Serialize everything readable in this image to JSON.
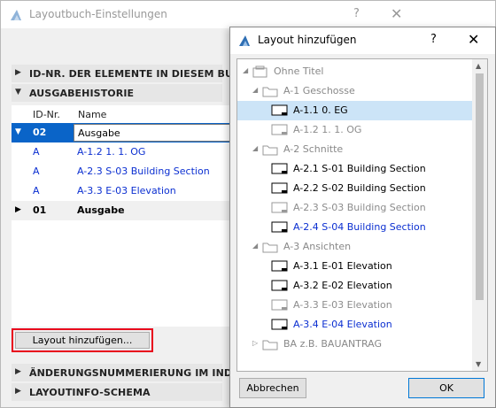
{
  "bg_window": {
    "title": "Layoutbuch-Einstellungen",
    "help": "?",
    "close": "✕",
    "sections": {
      "id_numbers": "ID-NR. DER ELEMENTE IN DIESEM BUCH",
      "history": "AUSGABEHISTORIE",
      "change_numbering": "ÄNDERUNGSNUMMERIERUNG IM INDEX",
      "layoutinfo": "LAYOUTINFO-SCHEMA"
    },
    "history_table": {
      "col_id": "ID-Nr.",
      "col_name": "Name",
      "rows": [
        {
          "id": "02",
          "name": "Ausgabe"
        },
        {
          "id": "A",
          "name": "A-1.2 1. 1. OG"
        },
        {
          "id": "A",
          "name": "A-2.3 S-03 Building Section"
        },
        {
          "id": "A",
          "name": "A-3.3 E-03 Elevation"
        },
        {
          "id": "01",
          "name": "Ausgabe"
        }
      ]
    },
    "add_layout_button": "Layout hinzufügen..."
  },
  "dialog": {
    "title": "Layout hinzufügen",
    "help": "?",
    "close": "✕",
    "tree": [
      {
        "label": "Ohne Titel"
      },
      {
        "label": "A-1 Geschosse"
      },
      {
        "label": "A-1.1 0. EG"
      },
      {
        "label": "A-1.2 1. 1. OG"
      },
      {
        "label": "A-2 Schnitte"
      },
      {
        "label": "A-2.1 S-01 Building Section"
      },
      {
        "label": "A-2.2 S-02 Building Section"
      },
      {
        "label": "A-2.3 S-03 Building Section"
      },
      {
        "label": "A-2.4 S-04 Building Section"
      },
      {
        "label": "A-3 Ansichten"
      },
      {
        "label": "A-3.1 E-01 Elevation"
      },
      {
        "label": "A-3.2 E-02 Elevation"
      },
      {
        "label": "A-3.3 E-03 Elevation"
      },
      {
        "label": "A-3.4 E-04 Elevation"
      },
      {
        "label": "BA z.B. BAUANTRAG"
      }
    ],
    "cancel_button": "Abbrechen",
    "ok_button": "OK"
  },
  "colors": {
    "selection": "#0a64c8",
    "highlight": "#cce4f7",
    "link_blue": "#0b2fd1",
    "focus_red": "#e8001c"
  }
}
